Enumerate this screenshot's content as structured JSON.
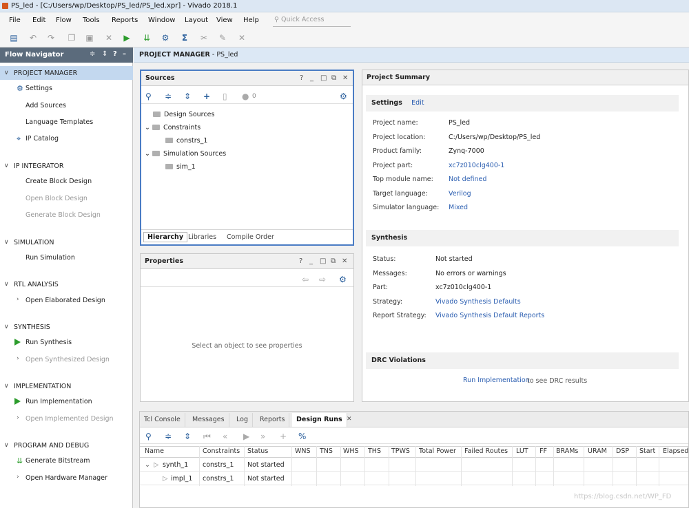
{
  "window": {
    "title": "PS_led - [C:/Users/wp/Desktop/PS_led/PS_led.xpr] - Vivado 2018.1"
  },
  "menu": [
    "File",
    "Edit",
    "Flow",
    "Tools",
    "Reports",
    "Window",
    "Layout",
    "View",
    "Help"
  ],
  "quick_access": {
    "placeholder": "Quick Access"
  },
  "toolbar_icons": [
    "open-project-icon",
    "undo-icon",
    "redo-icon",
    "copy-icon",
    "paste-icon",
    "delete-icon",
    "run-icon",
    "program-icon",
    "settings-icon",
    "sigma-icon",
    "cut-icon",
    "edit-icon",
    "cancel-icon"
  ],
  "nav": {
    "title": "Flow Navigator",
    "sections": [
      {
        "label": "PROJECT MANAGER",
        "items": [
          "Settings",
          "Add Sources",
          "Language Templates",
          "IP Catalog"
        ]
      },
      {
        "label": "IP INTEGRATOR",
        "items": [
          "Create Block Design",
          "Open Block Design",
          "Generate Block Design"
        ]
      },
      {
        "label": "SIMULATION",
        "items": [
          "Run Simulation"
        ]
      },
      {
        "label": "RTL ANALYSIS",
        "items": [
          "Open Elaborated Design"
        ]
      },
      {
        "label": "SYNTHESIS",
        "items": [
          "Run Synthesis",
          "Open Synthesized Design"
        ]
      },
      {
        "label": "IMPLEMENTATION",
        "items": [
          "Run Implementation",
          "Open Implemented Design"
        ]
      },
      {
        "label": "PROGRAM AND DEBUG",
        "items": [
          "Generate Bitstream",
          "Open Hardware Manager"
        ]
      }
    ]
  },
  "crumb": {
    "main": "PROJECT MANAGER",
    "sub": " - PS_led"
  },
  "sources": {
    "title": "Sources",
    "count": "0",
    "tree": [
      "Design Sources",
      "Constraints",
      "constrs_1",
      "Simulation Sources",
      "sim_1"
    ],
    "tabs": [
      "Hierarchy",
      "Libraries",
      "Compile Order"
    ]
  },
  "properties": {
    "title": "Properties",
    "empty": "Select an object to see properties"
  },
  "summary": {
    "title": "Project Summary",
    "settings_label": "Settings",
    "edit": "Edit",
    "settings": [
      {
        "k": "Project name:",
        "v": "PS_led"
      },
      {
        "k": "Project location:",
        "v": "C:/Users/wp/Desktop/PS_led"
      },
      {
        "k": "Product family:",
        "v": "Zynq-7000"
      },
      {
        "k": "Project part:",
        "v": "xc7z010clg400-1"
      },
      {
        "k": "Top module name:",
        "v": "Not defined"
      },
      {
        "k": "Target language:",
        "v": "Verilog"
      },
      {
        "k": "Simulator language:",
        "v": "Mixed"
      }
    ],
    "synthesis_label": "Synthesis",
    "synthesis": [
      {
        "k": "Status:",
        "v": "Not started"
      },
      {
        "k": "Messages:",
        "v": "No errors or warnings"
      },
      {
        "k": "Part:",
        "v": "xc7z010clg400-1"
      },
      {
        "k": "Strategy:",
        "v": "Vivado Synthesis Defaults"
      },
      {
        "k": "Report Strategy:",
        "v": "Vivado Synthesis Default Reports"
      }
    ],
    "drc_label": "DRC Violations",
    "drc_link": "Run Implementation",
    "drc_text": "to see DRC results"
  },
  "bottom": {
    "tabs": [
      "Tcl Console",
      "Messages",
      "Log",
      "Reports",
      "Design Runs"
    ],
    "columns": [
      "Name",
      "Constraints",
      "Status",
      "WNS",
      "TNS",
      "WHS",
      "THS",
      "TPWS",
      "Total Power",
      "Failed Routes",
      "LUT",
      "FF",
      "BRAMs",
      "URAM",
      "DSP",
      "Start",
      "Elapsed"
    ],
    "rows": [
      {
        "name": "synth_1",
        "constraints": "constrs_1",
        "status": "Not started"
      },
      {
        "name": "impl_1",
        "constraints": "constrs_1",
        "status": "Not started"
      }
    ],
    "watermark": "https://blog.csdn.net/WP_FD"
  }
}
